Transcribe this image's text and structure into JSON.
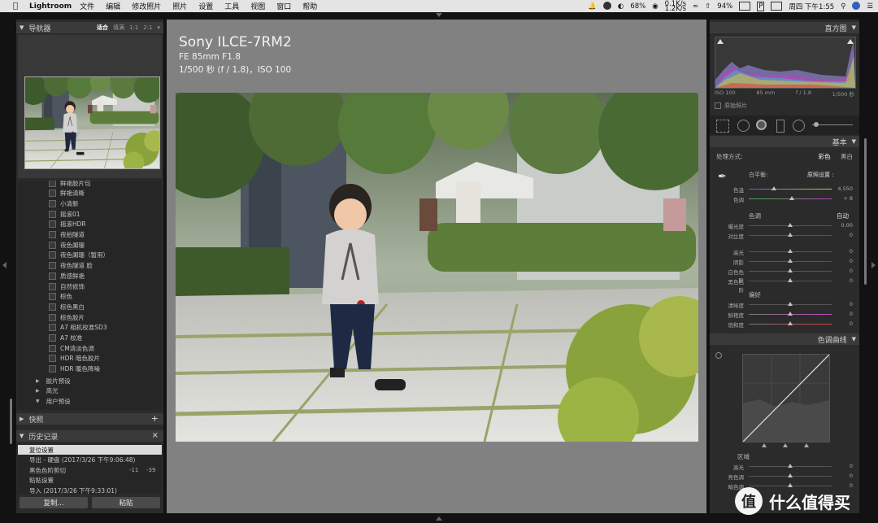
{
  "menubar": {
    "app": "Lightroom",
    "items": [
      "文件",
      "编辑",
      "修改照片",
      "照片",
      "设置",
      "工具",
      "视图",
      "窗口",
      "帮助"
    ],
    "battery_small": "68%",
    "net_up": "0.1K/s",
    "net_down": "1.2K/s",
    "battery": "94%",
    "clock": "周四 下午1:55"
  },
  "navigator": {
    "title": "导航器",
    "modes": [
      "适合",
      "填满",
      "1:1",
      "2:1"
    ],
    "active_mode": "适合"
  },
  "presets": {
    "items": [
      "鲜艳胶片包",
      "鲜艳清晰",
      "小清新",
      "摇滚01",
      "摇滚HDR",
      "夜拍隧道",
      "夜色阑珊",
      "夜色阑珊（暂用）",
      "夜色隧道 脸",
      "质感鲜艳",
      "自然修饰",
      "棕色",
      "棕色黑白",
      "棕色胶片",
      "A7 相机校准SD3",
      "A7 校准",
      "CM清淡色调",
      "HDR 暗色胶片",
      "HDR 暖色降噪"
    ],
    "folders": [
      "胶片预设",
      "高光",
      "用户预设"
    ]
  },
  "snapshots": {
    "title": "快照",
    "add": "+"
  },
  "history": {
    "title": "历史记录",
    "close": "×",
    "rows": [
      {
        "text": "复位设置",
        "v1": "",
        "v2": ""
      },
      {
        "text": "导出 - 硬盘 (2017/3/26 下午9:06:48)",
        "v1": "",
        "v2": ""
      },
      {
        "text": "黑色色阶剪切",
        "v1": "-11",
        "v2": "-39"
      },
      {
        "text": "粘贴设置",
        "v1": "",
        "v2": ""
      },
      {
        "text": "导入 (2017/3/26 下午9:33:01)",
        "v1": "",
        "v2": ""
      }
    ]
  },
  "buttons": {
    "copy": "复制...",
    "paste": "粘贴"
  },
  "camera": {
    "model": "Sony ILCE-7RM2",
    "lens": "FE 85mm F1.8",
    "exposure": "1/500 秒 (f / 1.8)，ISO 100"
  },
  "histogram": {
    "title": "直方图",
    "iso": "ISO 100",
    "focal": "85 mm",
    "aperture": "f / 1.8",
    "shutter": "1/500 秒",
    "original": "原始照片"
  },
  "basic": {
    "title": "基本",
    "treatment_label": "处理方式:",
    "color": "彩色",
    "bw": "黑白",
    "wb_label": "白平衡:",
    "wb_value": "原照设置 :",
    "tone_label": "色调",
    "auto": "自动",
    "presence_label": "偏好",
    "sliders": [
      {
        "label": "色温",
        "value": "4,550",
        "pos": 0.3
      },
      {
        "label": "色调",
        "value": "+ 8",
        "pos": 0.52
      },
      {
        "label": "曝光度",
        "value": "0.00",
        "pos": 0.5
      },
      {
        "label": "对比度",
        "value": "0",
        "pos": 0.5
      },
      {
        "label": "高光",
        "value": "0",
        "pos": 0.5
      },
      {
        "label": "阴影",
        "value": "0",
        "pos": 0.5
      },
      {
        "label": "白色色阶",
        "value": "0",
        "pos": 0.5
      },
      {
        "label": "黑色色阶",
        "value": "0",
        "pos": 0.5
      },
      {
        "label": "清晰度",
        "value": "0",
        "pos": 0.5
      },
      {
        "label": "鲜艳度",
        "value": "0",
        "pos": 0.5
      },
      {
        "label": "饱和度",
        "value": "0",
        "pos": 0.5
      }
    ]
  },
  "tonecurve": {
    "title": "色调曲线",
    "region": "区域",
    "sliders": [
      {
        "label": "高光",
        "value": "0"
      },
      {
        "label": "亮色调",
        "value": "0"
      },
      {
        "label": "暗色调",
        "value": "0"
      }
    ]
  },
  "watermark": {
    "text": "什么值得买",
    "logo": "值"
  }
}
